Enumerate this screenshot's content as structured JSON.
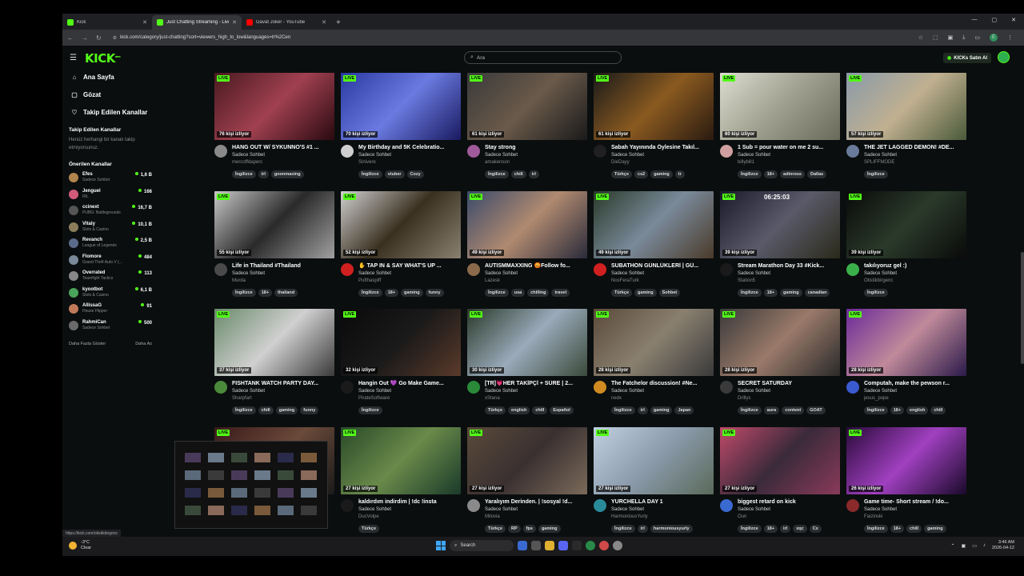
{
  "browser": {
    "tabs": [
      {
        "label": "Kick",
        "color": "#53fc18",
        "active": false
      },
      {
        "label": "Just Chatting Streaming - Live",
        "color": "#53fc18",
        "active": true
      },
      {
        "label": "Gavat Joker - YouTube",
        "color": "#ff0000",
        "active": false
      }
    ],
    "url": "kick.com/category/just-chatting?sort=viewers_high_to_low&languages=tr%2Cen",
    "status_url": "https://kick.com/otistikbirgenc"
  },
  "header": {
    "logo": "KICK",
    "logo_sup": "BETA",
    "search_placeholder": "Ara",
    "buy_button": "KICKs Satın Al"
  },
  "sidebar": {
    "nav": [
      {
        "label": "Ana Sayfa",
        "icon": "home-icon",
        "glyph": "⌂"
      },
      {
        "label": "Gözat",
        "icon": "browse-icon",
        "glyph": "▢"
      },
      {
        "label": "Takip Edilen Kanallar",
        "icon": "heart-icon",
        "glyph": "♡"
      }
    ],
    "following_title": "Takip Edilen Kanallar",
    "following_note": "Henüz herhangi bir kanalı takip etmiyorsunuz.",
    "recommended_title": "Önerilen Kanallar",
    "recommended": [
      {
        "name": "Efes",
        "category": "Sadece Sohbet",
        "viewers": "1,6 B",
        "color": "#b0854e"
      },
      {
        "name": "Jenguel",
        "category": "IRL",
        "viewers": "166",
        "color": "#d15a7a"
      },
      {
        "name": "ccinext",
        "category": "PUBG: Battlegrounds",
        "viewers": "16,7 B",
        "color": "#555"
      },
      {
        "name": "Vitaly",
        "category": "Slots & Casino",
        "viewers": "10,1 B",
        "color": "#8a7d5c"
      },
      {
        "name": "Revanch",
        "category": "League of Legends",
        "viewers": "2,5 B",
        "color": "#5a6a8a"
      },
      {
        "name": "Flomore",
        "category": "Grand Theft Auto V (...",
        "viewers": "484",
        "color": "#7a8a9a"
      },
      {
        "name": "Overrated",
        "category": "Teamfight Tactics",
        "viewers": "113",
        "color": "#888"
      },
      {
        "name": "kyootbot",
        "category": "Slots & Casino",
        "viewers": "6,1 B",
        "color": "#4aa35a"
      },
      {
        "name": "AllissaG",
        "category": "House Flipper",
        "viewers": "91",
        "color": "#c07a5a"
      },
      {
        "name": "RahmiCan",
        "category": "Sadece Sohbet",
        "viewers": "500",
        "color": "#6a6a6a"
      }
    ],
    "show_more": "Daha Fazla Göster",
    "show_less": "Daha Az"
  },
  "streams": [
    {
      "title": "HANG OUT W/ SYKUNNO'S #1 ...",
      "category": "Sadece Sohbet",
      "channel": "mercoffdaperc",
      "viewers": "76 kişi izliyor",
      "tags": [
        "İngilizce",
        "irl",
        "goonmaxing"
      ],
      "bg": "linear-gradient(135deg,#4a1a20,#a04050 50%,#2a0a10)",
      "av": "#8a8a8a"
    },
    {
      "title": "My Birthday and 5K Celebratio...",
      "category": "Sadece Sohbet",
      "channel": "Sinivere",
      "viewers": "70 kişi izliyor",
      "tags": [
        "İngilizce",
        "vtuber",
        "Cozy"
      ],
      "bg": "linear-gradient(135deg,#2a3aa0,#6a7ae0 50%,#1a1a60)",
      "av": "#cfcfcf"
    },
    {
      "title": "Stay strong",
      "category": "Sadece Sohbet",
      "channel": "amakenson",
      "viewers": "61 kişi izliyor",
      "tags": [
        "İngilizce",
        "chill",
        "irl"
      ],
      "bg": "linear-gradient(135deg,#3a3a3a,#6a5a4a 50%,#1a1a1a)",
      "av": "#a05a9a"
    },
    {
      "title": "Sabah Yayınında Öylesine Takıl...",
      "category": "Sadece Sohbet",
      "channel": "DieDayy",
      "viewers": "61 kişi izliyor",
      "tags": [
        "Türkçe",
        "cs2",
        "gaming",
        "tr"
      ],
      "bg": "linear-gradient(135deg,#1a1a1a,#8a5a20 50%,#2a1a10)",
      "av": "#202020"
    },
    {
      "title": "1 Sub = pour water on me 2 su...",
      "category": "Sadece Sohbet",
      "channel": "billybill1",
      "viewers": "60 kişi izliyor",
      "tags": [
        "İngilizce",
        "18+",
        "adinross",
        "Dallas"
      ],
      "bg": "linear-gradient(135deg,#dcdcd0,#a0a090 50%,#6a6a5a)",
      "av": "#d0a0a0"
    },
    {
      "title": "THE JET LAGGED DEMON! #DE...",
      "category": "Sadece Sohbet",
      "channel": "SPLIFFMODE",
      "viewers": "57 kişi izliyor",
      "tags": [
        "İngilizce"
      ],
      "bg": "linear-gradient(135deg,#8a9aaa,#c0b090 50%,#4a5a3a)",
      "av": "#6a7a9a"
    },
    {
      "title": "Life in Thailand #Thailand",
      "category": "Sadece Sohbet",
      "channel": "Murda",
      "viewers": "55 kişi izliyor",
      "tags": [
        "İngilizce",
        "18+",
        "thailand"
      ],
      "bg": "linear-gradient(135deg,#c8c8c8,#2a2a2a 50%,#a0a0a0)",
      "av": "#4a4a4a"
    },
    {
      "title": "✋ TAP IN & SAY WHAT'S UP ...",
      "category": "Sadece Sohbet",
      "channel": "Pufthaspiff",
      "viewers": "52 kişi izliyor",
      "tags": [
        "İngilizce",
        "18+",
        "gaming",
        "funny"
      ],
      "bg": "linear-gradient(135deg,#d0d0d0,#3a3020 50%,#8a8070)",
      "av": "#d02020"
    },
    {
      "title": "AUTISMMAXXING 😡Follow fo...",
      "category": "Sadece Sohbet",
      "channel": "Lazesk",
      "viewers": "49 kişi izliyor",
      "tags": [
        "İngilizce",
        "usa",
        "chilling",
        "travel"
      ],
      "bg": "linear-gradient(135deg,#3a4a6a,#b08a70 50%,#2a2a3a)",
      "av": "#8a6a4a"
    },
    {
      "title": "SUBATHON GÜNLÜKLERİ | GÜ...",
      "category": "Sadece Sohbet",
      "channel": "NosFeraTurk",
      "viewers": "49 kişi izliyor",
      "tags": [
        "Türkçe",
        "gaming",
        "Sohbet"
      ],
      "bg": "linear-gradient(135deg,#2a3a2a,#7a8a9a 50%,#4a3a2a)",
      "av": "#d02020"
    },
    {
      "title": "Stream Marathon Day 33 #Kick...",
      "category": "Sadece Sohbet",
      "channel": "Station5",
      "viewers": "39 kişi izliyor",
      "tags": [
        "İngilizce",
        "18+",
        "gaming",
        "canadian"
      ],
      "bg": "linear-gradient(135deg,#1a1a2a,#5a5a6a 50%,#2a2a1a)",
      "av": "#1a1a1a",
      "timer": "06:25:03"
    },
    {
      "title": "takılıyoruz gel :)",
      "category": "Sadece Sohbet",
      "channel": "Otistikbirgenc",
      "viewers": "39 kişi izliyor",
      "tags": [
        "İngilizce"
      ],
      "bg": "linear-gradient(135deg,#0a0a0a,#2a3a2a 50%,#0a0a0a)",
      "av": "#3ab04a"
    },
    {
      "title": "FISHTANK WATCH PARTY DAY...",
      "category": "Sadece Sohbet",
      "channel": "Sharpfart",
      "viewers": "37 kişi izliyor",
      "tags": [
        "İngilizce",
        "chill",
        "gaming",
        "funny"
      ],
      "bg": "linear-gradient(135deg,#6a8a6a,#d0d0d0 50%,#3a3a3a)",
      "av": "#4a8a3a"
    },
    {
      "title": "Hangin Out 💜 Go Make Game...",
      "category": "Sadece Sohbet",
      "channel": "PirateSoftware",
      "viewers": "32 kişi izliyor",
      "tags": [
        "İngilizce"
      ],
      "bg": "linear-gradient(135deg,#0a0a0a,#1a1a1a 50%,#5a3a2a)",
      "av": "#1a1a1a"
    },
    {
      "title": "[TR]💗HER TAKİPÇİ + SÜRE | 2...",
      "category": "Sadece Sohbet",
      "channel": "xStana",
      "viewers": "30 kişi izliyor",
      "tags": [
        "Türkçe",
        "english",
        "chill",
        "Español"
      ],
      "bg": "linear-gradient(135deg,#2a3a2a,#9aaaba 50%,#3a4a3a)",
      "av": "#2a8a3a"
    },
    {
      "title": "The Fatchelor discussion! #Ne...",
      "category": "Sadece Sohbet",
      "channel": "nedx",
      "viewers": "28 kişi izliyor",
      "tags": [
        "İngilizce",
        "irl",
        "gaming",
        "Japan"
      ],
      "bg": "linear-gradient(135deg,#5a4a3a,#8a8070 50%,#3a3a3a)",
      "av": "#d08a20"
    },
    {
      "title": "SECRET SATURDAY",
      "category": "Sadece Sohbet",
      "channel": "Drillys",
      "viewers": "28 kişi izliyor",
      "tags": [
        "İngilizce",
        "aura",
        "content",
        "GOAT"
      ],
      "bg": "linear-gradient(135deg,#3a3a3a,#9a7a6a 50%,#2a2a2a)",
      "av": "#3a3a3a"
    },
    {
      "title": "Computah, make the pewson r...",
      "category": "Sadece Sohbet",
      "channel": "jesus_pope",
      "viewers": "28 kişi izliyor",
      "tags": [
        "İngilizce",
        "18+",
        "english",
        "chill"
      ],
      "bg": "linear-gradient(135deg,#6a2a9a,#c08a9a 50%,#2a1a4a)",
      "av": "#3a5ad0"
    },
    {
      "title": "",
      "category": "",
      "channel": "",
      "viewers": "",
      "tags": [],
      "bg": "linear-gradient(135deg,#3a1a1a,#6a4a3a 50%,#1a1a1a)",
      "av": "#333",
      "hidden_meta": true
    },
    {
      "title": "kaldırdım indirdim | !dc !insta",
      "category": "Sadece Sohbet",
      "channel": "DucVolpe",
      "viewers": "27 kişi izliyor",
      "tags": [
        "Türkçe"
      ],
      "bg": "linear-gradient(135deg,#2a4a2a,#6a8a4a 50%,#1a3a2a)",
      "av": "#1a1a1a"
    },
    {
      "title": "Yaralıyım Derinden. | !sosyal !d...",
      "category": "Sadece Sohbet",
      "channel": "Milovia",
      "viewers": "27 kişi izliyor",
      "tags": [
        "Türkçe",
        "RP",
        "fps",
        "gaming"
      ],
      "bg": "linear-gradient(135deg,#5a4a3a,#3a3030 50%,#7a6a5a)",
      "av": "#8a8a8a"
    },
    {
      "title": "YURCHELLA DAY 1",
      "category": "Sadece Sohbet",
      "channel": "HarmoniousYurly",
      "viewers": "27 kişi izliyor",
      "tags": [
        "İngilizce",
        "irl",
        "harmoniousyurly"
      ],
      "bg": "linear-gradient(135deg,#c0d0e0,#8a9aaa 50%,#5a6a5a)",
      "av": "#2a8a9a"
    },
    {
      "title": "biggest retard on kick",
      "category": "Sadece Sohbet",
      "channel": "Ouri",
      "viewers": "27 kişi izliyor",
      "tags": [
        "İngilizce",
        "18+",
        "irl",
        "xqc",
        "Cx"
      ],
      "bg": "linear-gradient(135deg,#c04a6a,#3a2a3a 50%,#8a3a5a)",
      "av": "#3a6ad0"
    },
    {
      "title": "Game time- Short stream / !do...",
      "category": "Sadece Sohbet",
      "channel": "Faizinski",
      "viewers": "26 kişi izliyor",
      "tags": [
        "İngilizce",
        "18+",
        "chill",
        "gaming"
      ],
      "bg": "linear-gradient(135deg,#2a0a3a,#a040c0 50%,#1a0a2a)",
      "av": "#8a2a2a"
    }
  ],
  "live_label": "LIVE",
  "taskbar": {
    "temp": "-3°C",
    "weather": "Clear",
    "search": "Search",
    "time": "3:46 AM",
    "date": "2026-04-12"
  }
}
